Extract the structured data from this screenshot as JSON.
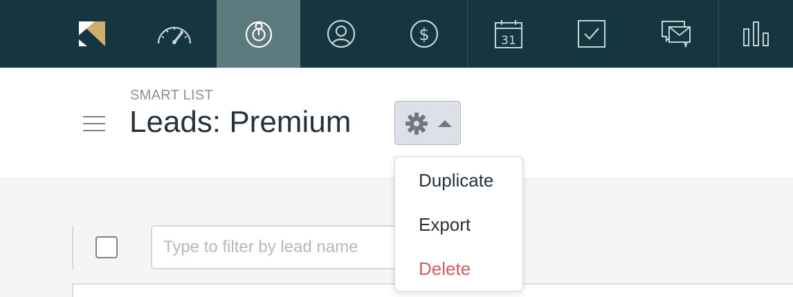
{
  "nav": {
    "items": [
      {
        "id": "logo",
        "icon": "brand-logo-icon"
      },
      {
        "id": "dashboard",
        "icon": "speedometer-icon"
      },
      {
        "id": "leads",
        "icon": "target-person-icon",
        "active": true
      },
      {
        "id": "contacts",
        "icon": "user-circle-icon"
      },
      {
        "id": "deals",
        "icon": "dollar-circle-icon"
      },
      {
        "id": "calendar",
        "icon": "calendar-icon",
        "day": "31"
      },
      {
        "id": "tasks",
        "icon": "checkbox-icon"
      },
      {
        "id": "messages",
        "icon": "envelope-chat-icon"
      },
      {
        "id": "reports",
        "icon": "bar-chart-icon"
      }
    ],
    "colors": {
      "background": "#153640",
      "active": "#5d7a7f",
      "logo_gold": "#cfae6c",
      "icon": "#c8d3d5"
    }
  },
  "header": {
    "kicker": "SMART LIST",
    "title": "Leads: Premium"
  },
  "toolbar": {
    "filter_placeholder": "Type to filter by lead name",
    "filter_value": ""
  },
  "dropdown": {
    "items": [
      {
        "label": "Duplicate",
        "style": "normal"
      },
      {
        "label": "Export",
        "style": "normal"
      },
      {
        "label": "Delete",
        "style": "danger",
        "color": "#d05c5c"
      }
    ]
  }
}
